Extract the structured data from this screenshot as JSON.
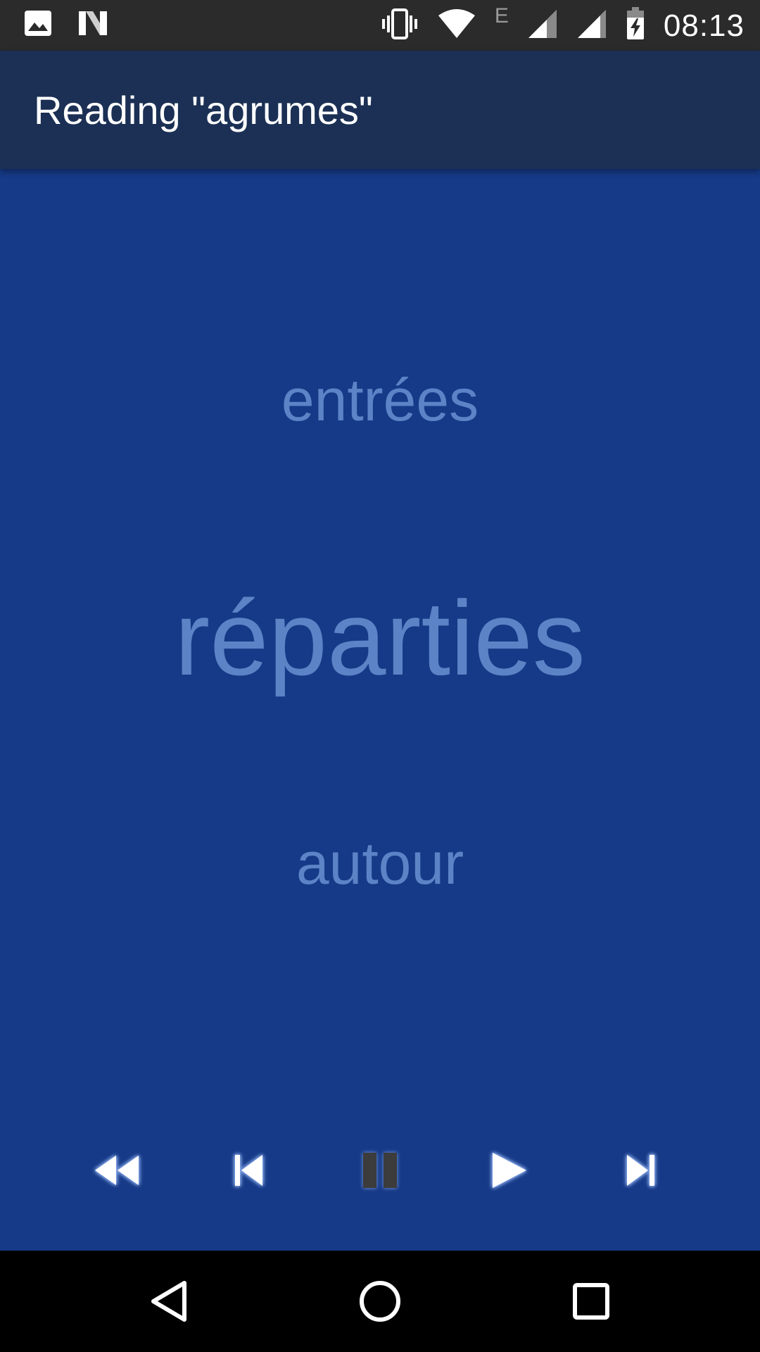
{
  "status_bar": {
    "time": "08:13",
    "network_label": "E",
    "icons": [
      "image-icon",
      "n-logo-icon",
      "vibrate-icon",
      "wifi-icon",
      "signal-icon",
      "signal-icon-2",
      "battery-charging-icon"
    ]
  },
  "app_bar": {
    "title": "Reading \"agrumes\""
  },
  "reader": {
    "previous_word": "entrées",
    "current_word": "réparties",
    "next_word": "autour"
  },
  "controls": {
    "icons": [
      "rewind-icon",
      "skip-previous-icon",
      "pause-icon",
      "play-icon",
      "skip-next-icon"
    ],
    "pause_state": "disabled"
  },
  "nav_bar": {
    "icons": [
      "back-icon",
      "home-icon",
      "recents-icon"
    ]
  },
  "colors": {
    "background": "#163a87",
    "app_bar": "#1b3054",
    "status_bar": "#2b2b2b",
    "word": "#5c83c6"
  }
}
